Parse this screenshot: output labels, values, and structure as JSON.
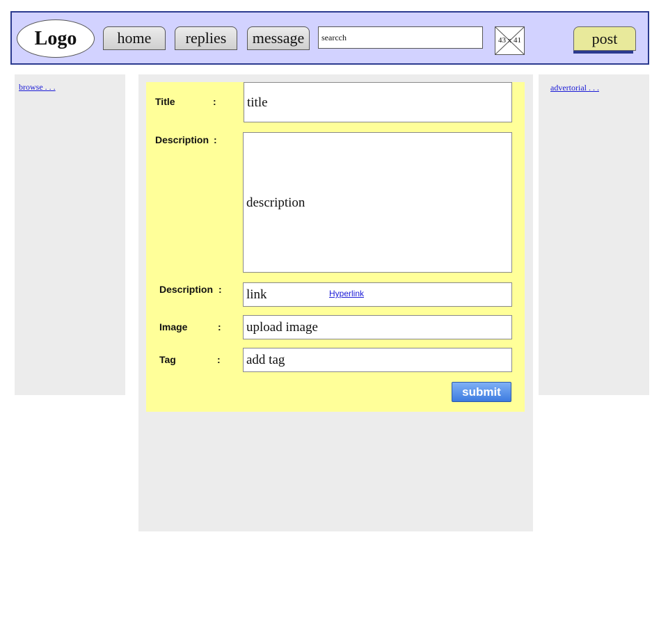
{
  "header": {
    "logo": "Logo",
    "nav": [
      {
        "label": "home"
      },
      {
        "label": "replies"
      },
      {
        "label": "message"
      }
    ],
    "search": {
      "value": "searcch"
    },
    "image_placeholder": "43 x 41",
    "post_label": "post"
  },
  "left_panel": {
    "link": "browse . . ."
  },
  "right_panel": {
    "link": "advertorial . . ."
  },
  "form": {
    "colon": ":",
    "title": {
      "label": "Title",
      "value": "title"
    },
    "description": {
      "label": "Description",
      "value": "description"
    },
    "link": {
      "label": "Description",
      "value": "link",
      "hyperlink": "Hyperlink"
    },
    "image": {
      "label": "Image",
      "value": "upload image"
    },
    "tag": {
      "label": "Tag",
      "value": "add tag"
    },
    "submit_label": "submit"
  },
  "colors": {
    "header_bg": "#d2d2ff",
    "header_border": "#2b3a8f",
    "form_bg": "#ffff99",
    "panel_bg": "#ececec",
    "post_bg": "#e8e99b",
    "submit_bg": "#3d7be0",
    "link": "#1a1ad6"
  }
}
